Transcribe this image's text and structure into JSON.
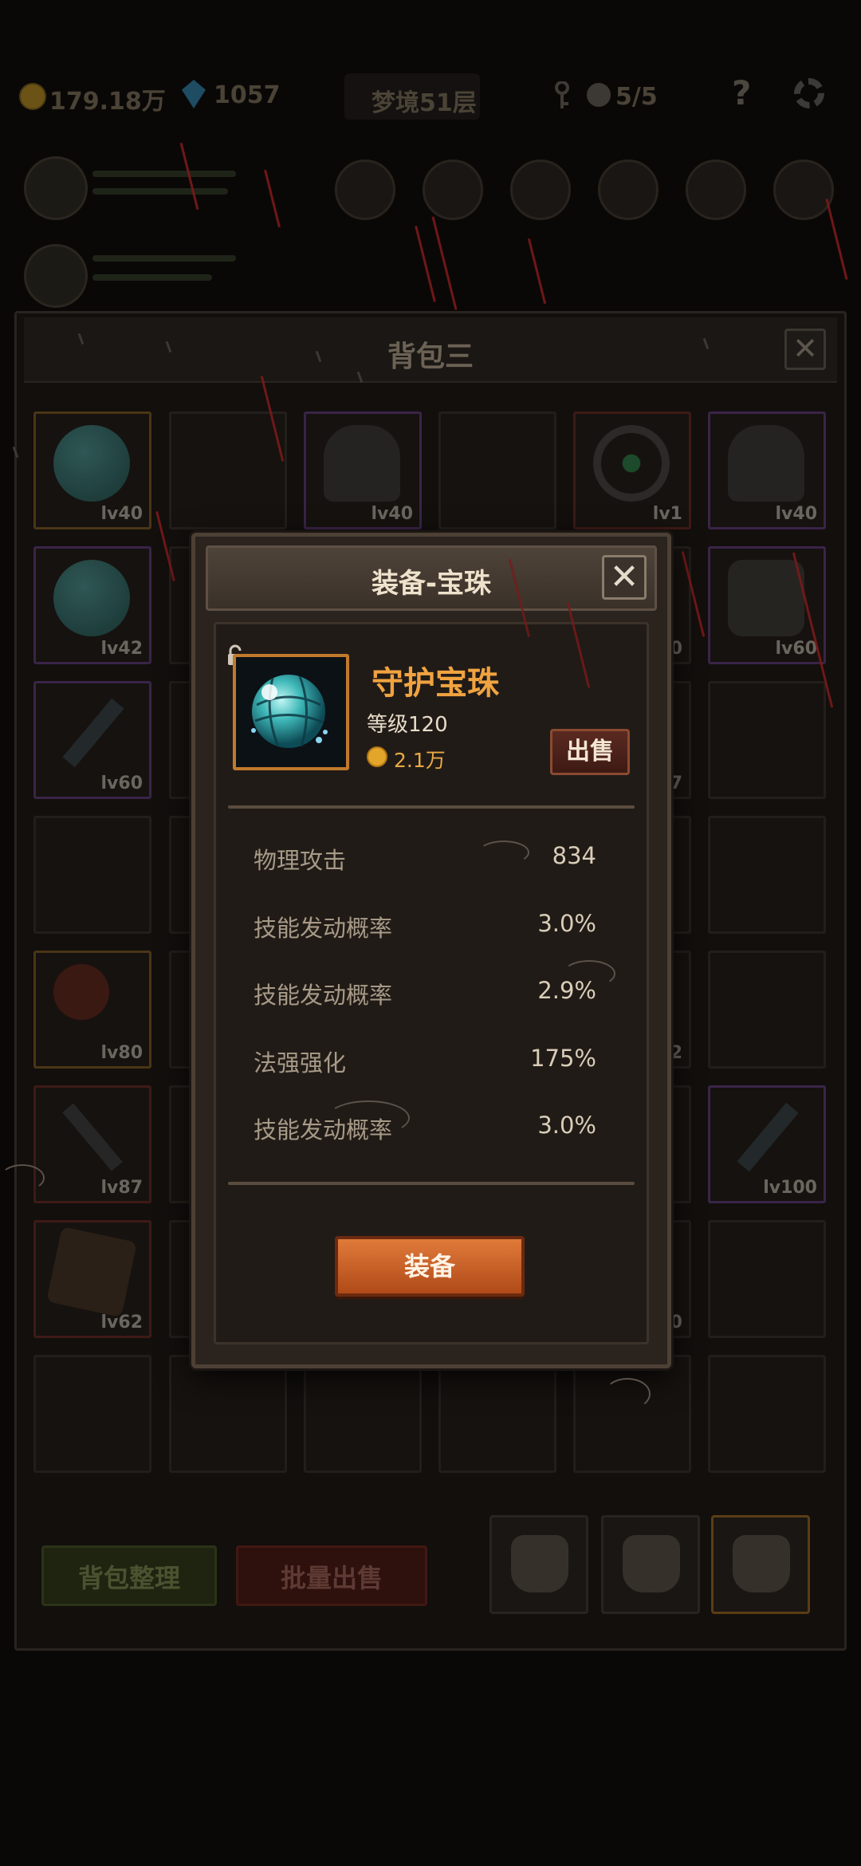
{
  "topbar": {
    "gold": "179.18万",
    "gems": "1057",
    "floor": "梦境51层",
    "skull_count": "5/5",
    "help": "?"
  },
  "bag": {
    "title": "背包三",
    "close": "✕",
    "slots": [
      {
        "lv": "lv40"
      },
      {
        "lv": ""
      },
      {
        "lv": "lv40"
      },
      {
        "lv": ""
      },
      {
        "lv": "lv1"
      },
      {
        "lv": "lv40"
      },
      {
        "lv": "lv42"
      },
      {
        "lv": ""
      },
      {
        "lv": ""
      },
      {
        "lv": ""
      },
      {
        "lv": "0"
      },
      {
        "lv": "lv60"
      },
      {
        "lv": "lv60"
      },
      {
        "lv": ""
      },
      {
        "lv": ""
      },
      {
        "lv": ""
      },
      {
        "lv": "7"
      },
      {
        "lv": ""
      },
      {
        "lv": ""
      },
      {
        "lv": ""
      },
      {
        "lv": ""
      },
      {
        "lv": ""
      },
      {
        "lv": ""
      },
      {
        "lv": ""
      },
      {
        "lv": "lv80"
      },
      {
        "lv": ""
      },
      {
        "lv": ""
      },
      {
        "lv": ""
      },
      {
        "lv": "2"
      },
      {
        "lv": ""
      },
      {
        "lv": "lv87"
      },
      {
        "lv": ""
      },
      {
        "lv": ""
      },
      {
        "lv": ""
      },
      {
        "lv": ""
      },
      {
        "lv": "lv100"
      },
      {
        "lv": "lv62"
      },
      {
        "lv": ""
      },
      {
        "lv": ""
      },
      {
        "lv": ""
      },
      {
        "lv": "20"
      },
      {
        "lv": ""
      },
      {
        "lv": ""
      },
      {
        "lv": ""
      },
      {
        "lv": ""
      },
      {
        "lv": ""
      },
      {
        "lv": ""
      },
      {
        "lv": ""
      }
    ],
    "sort_button": "背包整理",
    "bulk_sell_button": "批量出售"
  },
  "modal": {
    "title": "装备-宝珠",
    "close": "✕",
    "item_name": "守护宝珠",
    "item_level": "等级120",
    "price": "2.1万",
    "sell_button": "出售",
    "stats": [
      {
        "name": "物理攻击",
        "value": "834"
      },
      {
        "name": "技能发动概率",
        "value": "3.0%"
      },
      {
        "name": "技能发动概率",
        "value": "2.9%"
      },
      {
        "name": "法强强化",
        "value": "175%"
      },
      {
        "name": "技能发动概率",
        "value": "3.0%"
      }
    ],
    "equip_button": "装备"
  },
  "colors": {
    "item_name": "#f0a340",
    "price": "#e8a945",
    "equip_button": "#c85a22",
    "quality_border": "#c07a2c"
  }
}
